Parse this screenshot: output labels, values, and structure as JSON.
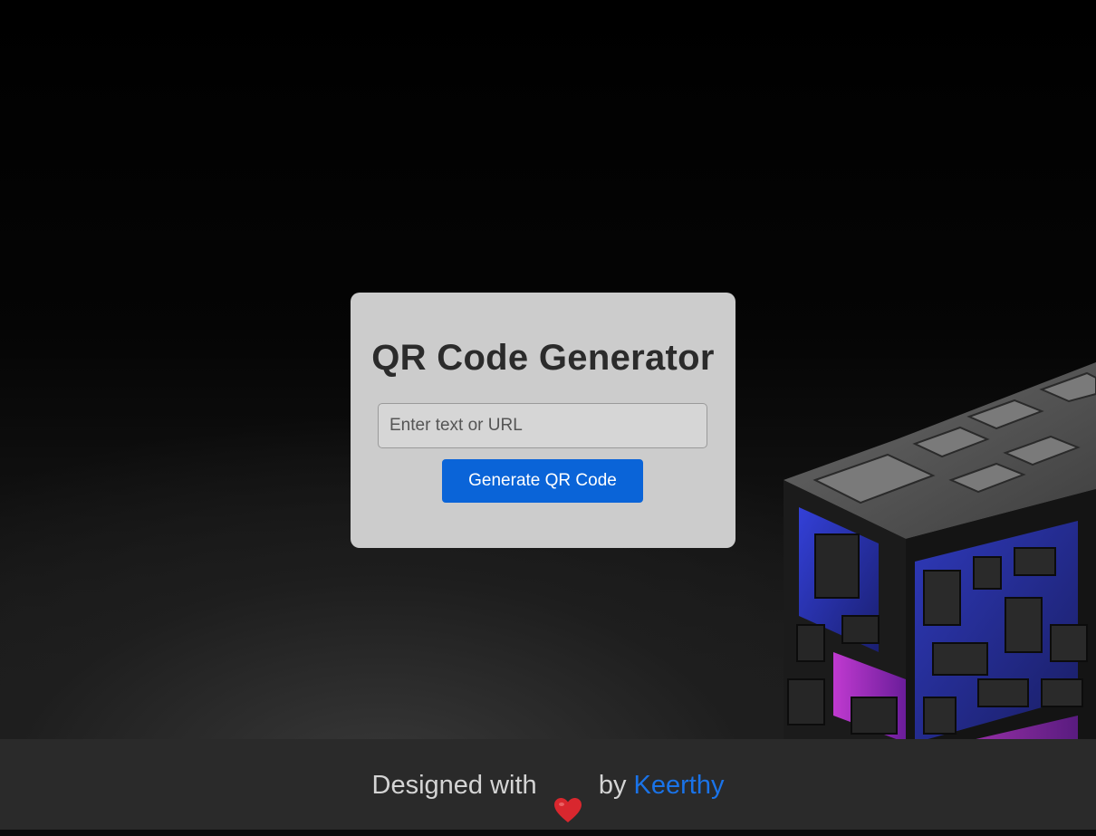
{
  "app": {
    "title": "QR Code Generator"
  },
  "form": {
    "input_placeholder": "Enter text or URL",
    "input_value": "",
    "button_label": "Generate QR Code"
  },
  "footer": {
    "prefix": "Designed with",
    "heart_icon": "heart-icon",
    "by": "by",
    "author": "Keerthy"
  },
  "colors": {
    "card_bg": "#cccccc",
    "button_bg": "#0a64d8",
    "link": "#1a73e8",
    "footer_bg": "#2a2a2a",
    "heart": "#d9272e"
  }
}
